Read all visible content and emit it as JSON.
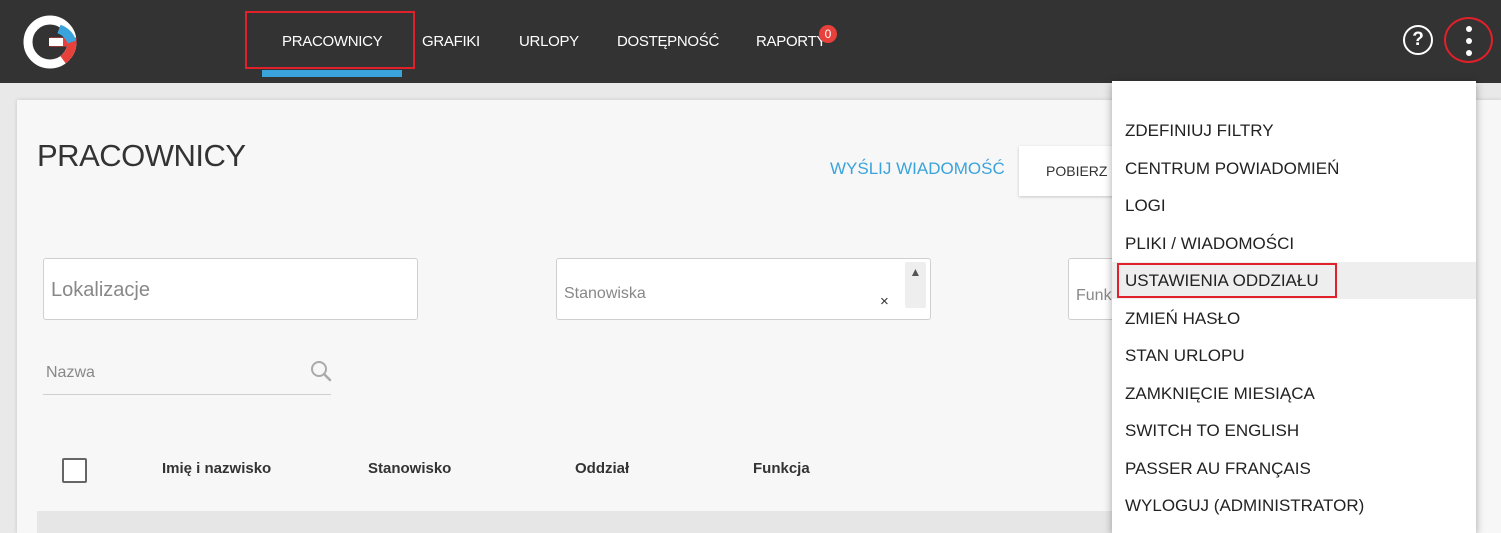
{
  "nav": {
    "items": [
      {
        "label": "PRACOWNICY"
      },
      {
        "label": "GRAFIKI"
      },
      {
        "label": "URLOPY"
      },
      {
        "label": "DOSTĘPNOŚĆ"
      },
      {
        "label": "RAPORTY"
      }
    ],
    "active_index": 0,
    "raporty_badge": "0",
    "help_icon": "?",
    "colors": {
      "bar": "#333333",
      "accent": "#3aa3dc",
      "highlight": "#e0202a",
      "badge": "#e8403a"
    }
  },
  "page": {
    "title": "PRACOWNICY",
    "send_message": "WYŚLIJ WIADOMOŚĆ",
    "download_label": "POBIERZ"
  },
  "filters": {
    "lokalizacje": "Lokalizacje",
    "stanowiska": "Stanowiska",
    "funkcje": "Funkcje",
    "clear_icon": "×",
    "name_placeholder": "Nazwa"
  },
  "table": {
    "headers": [
      "Imię i nazwisko",
      "Stanowisko",
      "Oddział",
      "Funkcja"
    ]
  },
  "dropdown": {
    "items": [
      {
        "label": "ZDEFINIUJ FILTRY"
      },
      {
        "label": "CENTRUM POWIADOMIEŃ"
      },
      {
        "label": "LOGI"
      },
      {
        "label": "PLIKI / WIADOMOŚCI"
      },
      {
        "label": "USTAWIENIA ODDZIAŁU"
      },
      {
        "label": "ZMIEŃ HASŁO"
      },
      {
        "label": "STAN URLOPU"
      },
      {
        "label": "ZAMKNIĘCIE MIESIĄCA"
      },
      {
        "label": "SWITCH TO ENGLISH"
      },
      {
        "label": "PASSER AU FRANÇAIS"
      },
      {
        "label": "WYLOGUJ (ADMINISTRATOR)"
      }
    ],
    "highlighted_index": 4
  }
}
